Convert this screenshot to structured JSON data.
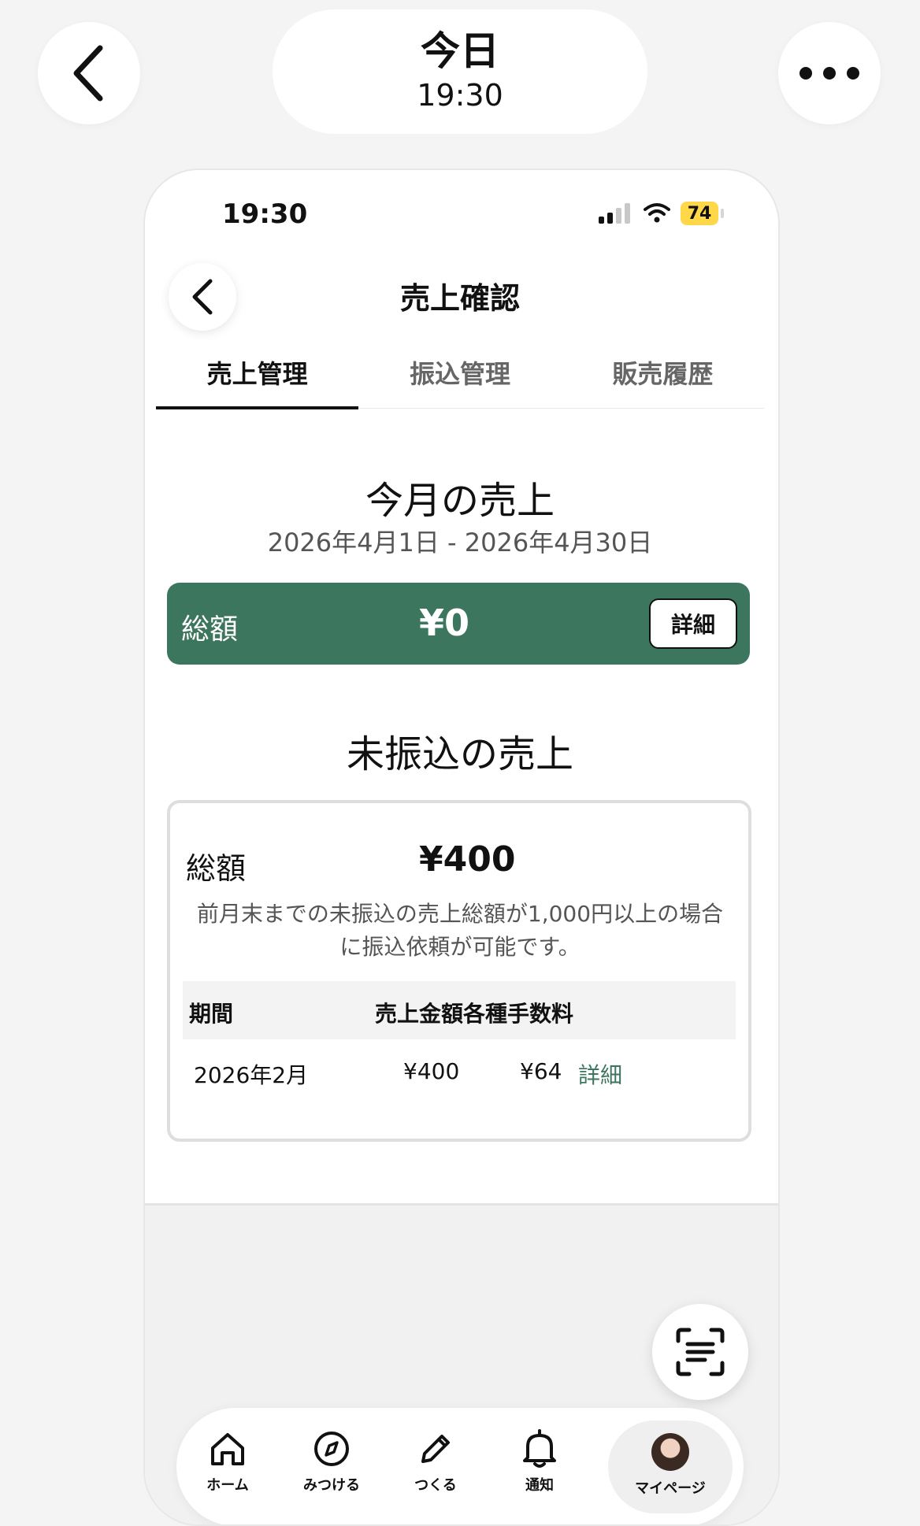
{
  "viewer": {
    "title": "今日",
    "time": "19:30"
  },
  "status": {
    "time": "19:30",
    "battery": "74"
  },
  "nav": {
    "title": "売上確認"
  },
  "tabs": [
    "売上管理",
    "振込管理",
    "販売履歴"
  ],
  "monthly": {
    "title": "今月の売上",
    "range": "2026年4月1日 - 2026年4月30日",
    "total_label": "総額",
    "total_value": "¥0",
    "detail_label": "詳細"
  },
  "unpaid": {
    "title": "未振込の売上",
    "total_label": "総額",
    "total_value": "¥400",
    "note": "前月末までの未振込の売上総額が1,000円以上の場合に振込依頼が可能です。",
    "headers": [
      "期間",
      "売上金額",
      "各種手数料"
    ],
    "rows": [
      {
        "period": "2026年2月",
        "amount": "¥400",
        "fee": "¥64",
        "link": "詳細"
      }
    ]
  },
  "tabbar": {
    "items": [
      {
        "label": "ホーム",
        "icon": "home-icon"
      },
      {
        "label": "みつける",
        "icon": "compass-icon"
      },
      {
        "label": "つくる",
        "icon": "pencil-icon"
      },
      {
        "label": "通知",
        "icon": "bell-icon"
      },
      {
        "label": "マイページ",
        "icon": "avatar"
      }
    ]
  },
  "colors": {
    "accent_green": "#3d765f"
  }
}
